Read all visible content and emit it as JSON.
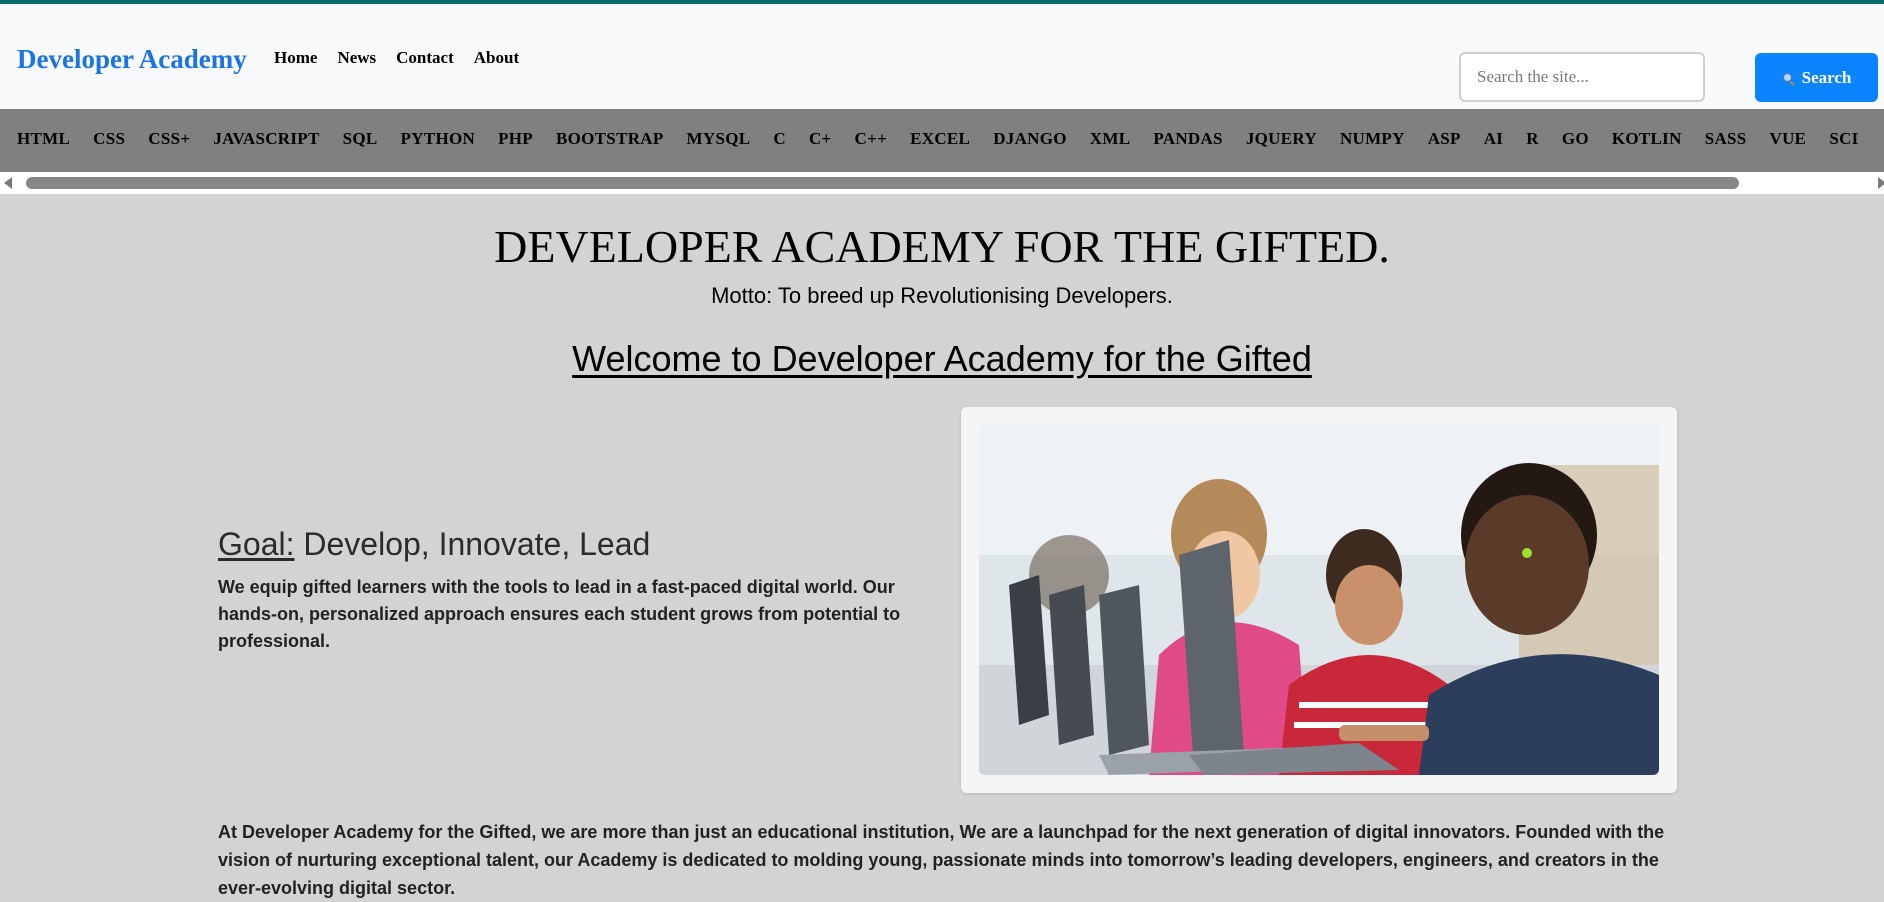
{
  "header": {
    "brand": "Developer Academy",
    "nav": [
      "Home",
      "News",
      "Contact",
      "About"
    ],
    "search": {
      "placeholder": "Search the site...",
      "button_label": "Search"
    }
  },
  "categories": [
    "HTML",
    "CSS",
    "CSS+",
    "JAVASCRIPT",
    "SQL",
    "PYTHON",
    "PHP",
    "BOOTSTRAP",
    "MYSQL",
    "C",
    "C+",
    "C++",
    "EXCEL",
    "DJANGO",
    "XML",
    "PANDAS",
    "JQUERY",
    "NUMPY",
    "ASP",
    "AI",
    "R",
    "GO",
    "KOTLIN",
    "SASS",
    "VUE",
    "SCI"
  ],
  "hero": {
    "title": "DEVELOPER ACADEMY FOR THE GIFTED.",
    "motto": "Motto: To breed up Revolutionising Developers.",
    "welcome": "Welcome to Developer Academy for the Gifted"
  },
  "goal": {
    "label": "Goal:",
    "headline": " Develop, Innovate, Lead",
    "text": "We equip gifted learners with the tools to lead in a fast-paced digital world. Our hands-on, personalized approach ensures each student grows from potential to professional."
  },
  "intro": "At Developer Academy for the Gifted, we are more than just an educational institution, We are a launchpad for the next generation of digital innovators. Founded with the vision of nurturing exceptional talent, our Academy is dedicated to molding young, passionate minds into tomorrow’s leading developers, engineers, and creators in the ever-evolving digital sector.",
  "colors": {
    "brand": "#1a73e8",
    "search_button": "#0a84ff",
    "top_accent": "#0f6b6b",
    "category_bar": "#808080",
    "page_background": "#d3d3d3"
  },
  "icons": {
    "search_button_icon": "magnifying-glass-icon"
  }
}
